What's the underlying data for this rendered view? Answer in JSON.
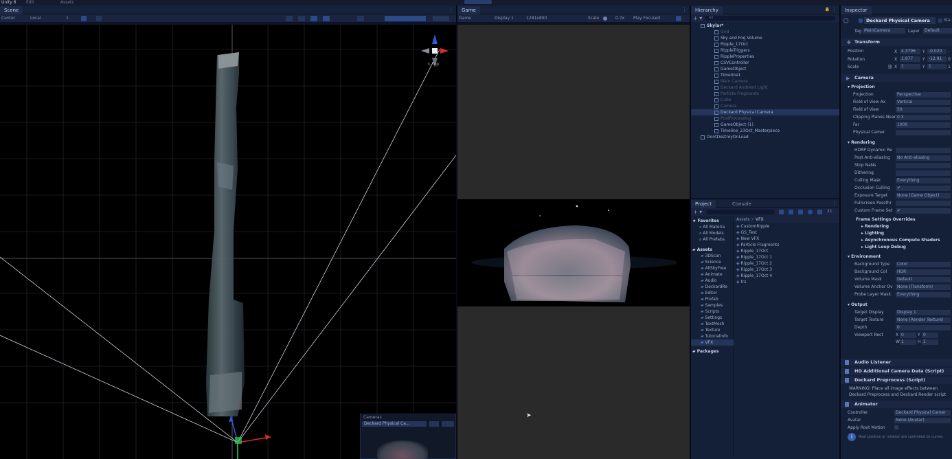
{
  "topbar": {
    "title": "Unity 6",
    "items": [
      "Edit",
      "Assets",
      "Window"
    ]
  },
  "scene": {
    "tab": "Scene",
    "toolbar": {
      "pivot": "Center",
      "space": "Local",
      "snap": "1"
    },
    "gizmo_label": "< Top",
    "cameras_overlay": {
      "title": "Cameras",
      "selected": "Deckard Physical Ca..."
    }
  },
  "game": {
    "tab": "Game",
    "toolbar": {
      "mode": "Game",
      "display": "Display 1",
      "resolution": "1281x800",
      "scale_label": "Scale",
      "scale_value": "0.7x",
      "play_focused": "Play Focused"
    }
  },
  "hierarchy": {
    "tab": "Hierarchy",
    "search_placeholder": "All",
    "rows": [
      {
        "label": "Skylar*",
        "depth": 0,
        "style": "hdr"
      },
      {
        "label": "Grid",
        "depth": 1,
        "style": "dim"
      },
      {
        "label": "Sky and Fog Volume",
        "depth": 1,
        "style": ""
      },
      {
        "label": "Ripple_17Oct",
        "depth": 1,
        "style": ""
      },
      {
        "label": "RippleTriggers",
        "depth": 1,
        "style": ""
      },
      {
        "label": "RippleProperties",
        "depth": 1,
        "style": ""
      },
      {
        "label": "CSVController",
        "depth": 1,
        "style": ""
      },
      {
        "label": "GameObject",
        "depth": 1,
        "style": ""
      },
      {
        "label": "Timeline1",
        "depth": 1,
        "style": ""
      },
      {
        "label": "Main Camera",
        "depth": 1,
        "style": "dim"
      },
      {
        "label": "Deckard Ambient Light",
        "depth": 1,
        "style": "dim"
      },
      {
        "label": "Particle Fragments",
        "depth": 1,
        "style": "dim"
      },
      {
        "label": "Cube",
        "depth": 1,
        "style": "dim"
      },
      {
        "label": "Camera",
        "depth": 1,
        "style": "dim"
      },
      {
        "label": "Deckard Physical Camera",
        "depth": 1,
        "style": "selected"
      },
      {
        "label": "PostProcessing",
        "depth": 1,
        "style": "dim"
      },
      {
        "label": "GameObject (1)",
        "depth": 1,
        "style": ""
      },
      {
        "label": "Timeline_23Oct_Masterpiece",
        "depth": 1,
        "style": ""
      },
      {
        "label": "DontDestroyOnLoad",
        "depth": 0,
        "style": ""
      }
    ]
  },
  "project": {
    "tabs": [
      "Project",
      "Console"
    ],
    "count_badge": "21",
    "breadcrumb": [
      "Assets",
      "VFX"
    ],
    "favorites_label": "Favorites",
    "favorites": [
      "All Materia",
      "All Models",
      "All Prefabs"
    ],
    "assets_label": "Assets",
    "folders": [
      "3DScan",
      "Science",
      "AllSkyFree",
      "Animate",
      "Audio",
      "DeckardRe",
      "Editor",
      "Prefab",
      "Samples",
      "Scripts",
      "Settings",
      "TextMesh",
      "Texture",
      "TutorialInfo",
      "VFX"
    ],
    "packages_label": "Packages",
    "files": [
      "CustomRipple",
      "GS_Test",
      "New VFX",
      "Particle Fragments",
      "Ripple_17Oct",
      "Ripple_17Oct 1",
      "Ripple_17Oct 2",
      "Ripple_17Oct 3",
      "Ripple_17Oct 4",
      "trs"
    ]
  },
  "inspector": {
    "tab": "Inspector",
    "object_name": "Deckard Physical Camera",
    "static_label": "Sta",
    "tag_label": "Tag",
    "tag_value": "MainCamera",
    "layer_label": "Layer",
    "layer_value": "Default",
    "transform": {
      "title": "Transform",
      "position": {
        "label": "Position",
        "x": "4.3796",
        "y": "-0.020",
        "z": "-"
      },
      "rotation": {
        "label": "Rotation",
        "x": "1.977",
        "y": "-12.91",
        "z": "0"
      },
      "scale": {
        "label": "Scale",
        "x": "1",
        "y": "1",
        "z": "1"
      }
    },
    "camera": {
      "title": "Camera",
      "projection_header": "Projection",
      "rows": [
        {
          "label": "Projection",
          "value": "Perspective"
        },
        {
          "label": "Field of View Ax",
          "value": "Vertical"
        },
        {
          "label": "Field of View",
          "value": "50"
        },
        {
          "label": "Clipping Planes Near",
          "value": "0.3"
        },
        {
          "label": "Far",
          "value": "1000"
        },
        {
          "label": "Physical Camer",
          "value": ""
        }
      ],
      "rendering_header": "Rendering",
      "rendering_rows": [
        {
          "label": "HDRP Dynamic Re",
          "value": ""
        },
        {
          "label": "Post Anti-aliasing",
          "value": "No Anti-aliasing"
        },
        {
          "label": "Stop NaNs",
          "value": ""
        },
        {
          "label": "Dithering",
          "value": ""
        },
        {
          "label": "Culling Mask",
          "value": "Everything"
        },
        {
          "label": "Occlusion Culling",
          "value": "✔"
        },
        {
          "label": "Exposure Target",
          "value": "None (Game Object)"
        },
        {
          "label": "Fullscreen Passthr",
          "value": ""
        },
        {
          "label": "Custom Frame Set",
          "value": "✔"
        }
      ],
      "frame_overrides_header": "Frame Settings Overrides",
      "frame_overrides": [
        "Rendering",
        "Lighting",
        "Asynchronous Compute Shaders",
        "Light Loop Debug"
      ],
      "environment_header": "Environment",
      "environment_rows": [
        {
          "label": "Background Type",
          "value": "Color"
        },
        {
          "label": "Background Col",
          "value": "HDR"
        },
        {
          "label": "Volume Mask",
          "value": "Default"
        },
        {
          "label": "Volume Anchor Ov",
          "value": "None (Transform)"
        },
        {
          "label": "Probe Layer Mask",
          "value": "Everything"
        }
      ],
      "output_header": "Output",
      "output_rows": [
        {
          "label": "Target Display",
          "value": "Display 1"
        },
        {
          "label": "Target Texture",
          "value": "None (Render Texture)"
        },
        {
          "label": "Depth",
          "value": "0"
        }
      ],
      "viewport": {
        "label": "Viewport Rect",
        "x": "0",
        "y": "0",
        "w": "1",
        "h": "1"
      }
    },
    "components": [
      "Audio Listener",
      "HD Additional Camera Data (Script)",
      "Deckard Preprocess (Script)",
      "Animator"
    ],
    "warning_text": "WARNING! Place all image effects between Deckard Preprocess and Deckard Render script",
    "animator": {
      "controller_label": "Controller",
      "controller_value": "Deckard Physical Camer",
      "avatar_label": "Avatar",
      "avatar_value": "None (Avatar)",
      "root_motion_label": "Apply Root Motion"
    },
    "footer_info": "Root position or rotation are controlled by curves"
  },
  "colors": {
    "accent": "#3a5fb0",
    "selection": "#24345a",
    "axis_x": "#e02a2a",
    "axis_y": "#2ad04a",
    "axis_z": "#2a5ae0"
  }
}
